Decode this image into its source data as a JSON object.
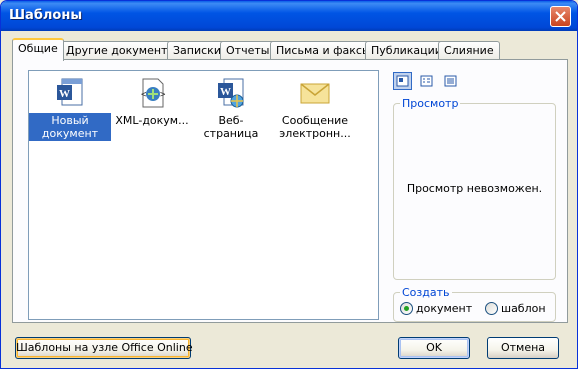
{
  "window": {
    "title": "Шаблоны"
  },
  "tabs": [
    {
      "label": "Общие",
      "active": true
    },
    {
      "label": "Другие документы",
      "active": false
    },
    {
      "label": "Записки",
      "active": false
    },
    {
      "label": "Отчеты",
      "active": false
    },
    {
      "label": "Письма и факсы",
      "active": false
    },
    {
      "label": "Публикации",
      "active": false
    },
    {
      "label": "Слияние",
      "active": false
    }
  ],
  "templates": [
    {
      "label": "Новый документ",
      "icon": "word-document-icon",
      "selected": true
    },
    {
      "label": "XML-докум...",
      "icon": "xml-document-icon",
      "selected": false
    },
    {
      "label": "Веб-страница",
      "icon": "web-page-icon",
      "selected": false
    },
    {
      "label": "Сообщение электронн...",
      "icon": "email-envelope-icon",
      "selected": false
    }
  ],
  "view_buttons": [
    {
      "icon": "large-icons-view-icon",
      "active": true
    },
    {
      "icon": "list-view-icon",
      "active": false
    },
    {
      "icon": "details-view-icon",
      "active": false
    }
  ],
  "preview": {
    "title": "Просмотр",
    "text": "Просмотр невозможен."
  },
  "create": {
    "title": "Создать",
    "options": [
      {
        "label": "документ",
        "checked": true
      },
      {
        "label": "шаблон",
        "checked": false
      }
    ]
  },
  "buttons": {
    "online": "Шаблоны на узле Office Online",
    "ok": "OK",
    "cancel": "Отмена"
  },
  "colors": {
    "titlebar": "#0055e5",
    "selection": "#316ac5",
    "group_title": "#0046d5"
  }
}
